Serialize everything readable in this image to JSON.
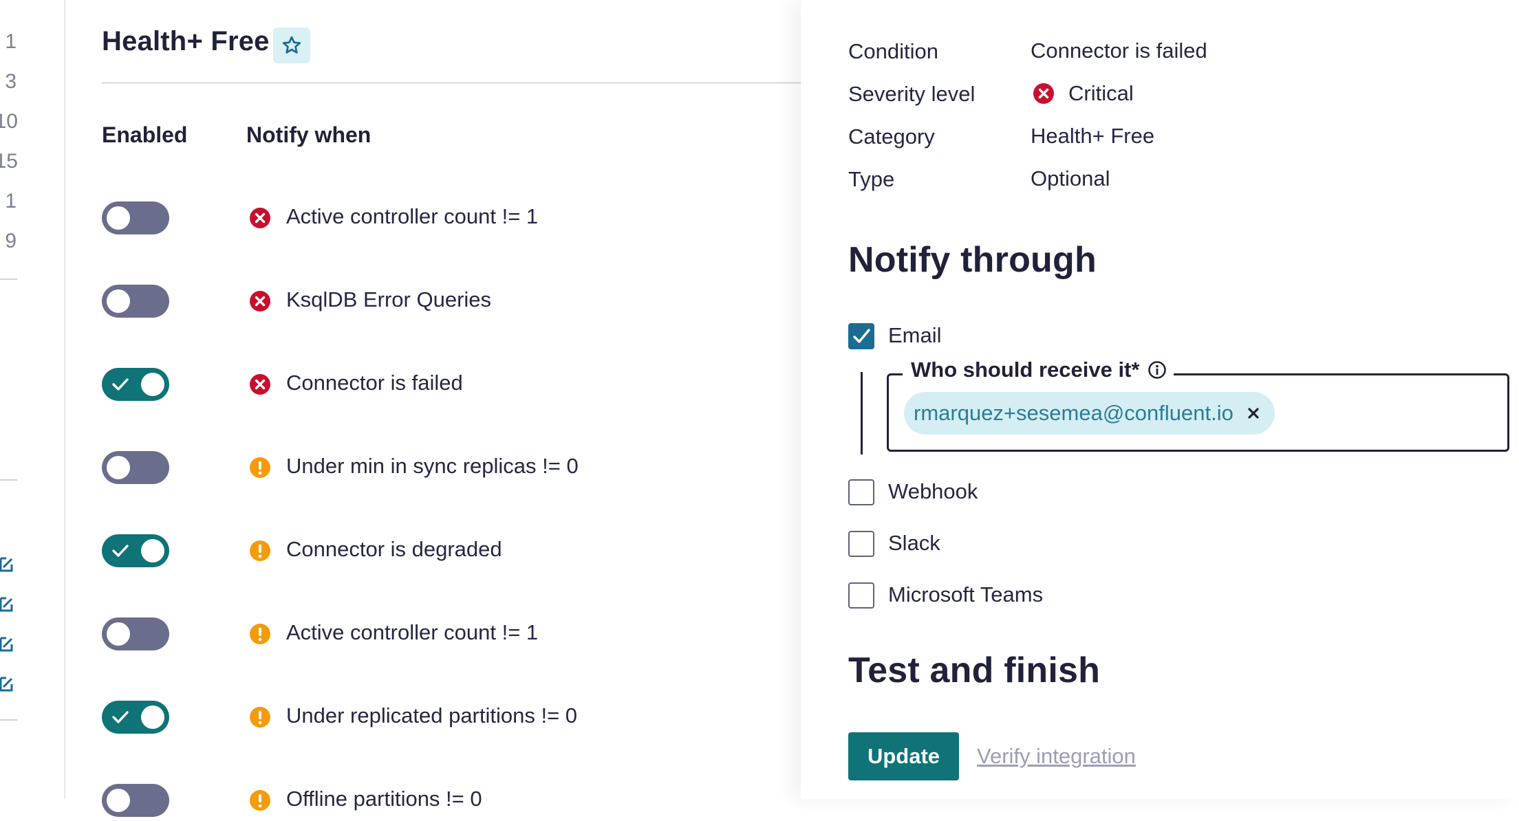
{
  "gutter": {
    "numbers": [
      "1",
      "3",
      "10",
      "15",
      "1",
      "9"
    ]
  },
  "left_panel": {
    "title": "Health+ Free",
    "columns": {
      "enabled": "Enabled",
      "notify_when": "Notify when"
    },
    "rules": [
      {
        "label": "Active controller count != 1",
        "enabled": false,
        "severity": "critical"
      },
      {
        "label": "KsqlDB Error Queries",
        "enabled": false,
        "severity": "critical"
      },
      {
        "label": "Connector is failed",
        "enabled": true,
        "severity": "critical"
      },
      {
        "label": "Under min in sync replicas != 0",
        "enabled": false,
        "severity": "warning"
      },
      {
        "label": "Connector is degraded",
        "enabled": true,
        "severity": "warning"
      },
      {
        "label": "Active controller count != 1",
        "enabled": false,
        "severity": "warning"
      },
      {
        "label": "Under replicated partitions != 0",
        "enabled": true,
        "severity": "warning"
      },
      {
        "label": "Offline partitions != 0",
        "enabled": false,
        "severity": "warning"
      }
    ]
  },
  "details": {
    "condition_label": "Condition",
    "condition_value": "Connector is failed",
    "severity_label": "Severity level",
    "severity_value": "Critical",
    "category_label": "Category",
    "category_value": "Health+ Free",
    "type_label": "Type",
    "type_value": "Optional"
  },
  "notify_through": {
    "heading": "Notify through",
    "email_label": "Email",
    "email_checked": true,
    "recipients_legend": "Who should receive it*",
    "recipient_chip": "rmarquez+sesemea@confluent.io",
    "webhook_label": "Webhook",
    "slack_label": "Slack",
    "teams_label": "Microsoft Teams"
  },
  "test_finish": {
    "heading": "Test and finish",
    "update_label": "Update",
    "verify_label": "Verify integration"
  },
  "colors": {
    "teal": "#0f7377",
    "toggle_off": "#6a6d8c",
    "critical": "#c8102e",
    "warning": "#f59b0b",
    "checkbox": "#1b6c93",
    "chip_bg": "#d4eef4",
    "chip_text": "#2b7c97"
  },
  "icons": {
    "star": "star-outline-icon",
    "critical": "x-circle-icon",
    "warning": "exclamation-circle-icon",
    "info": "info-circle-icon",
    "remove": "close-icon",
    "edit": "edit-icon"
  }
}
